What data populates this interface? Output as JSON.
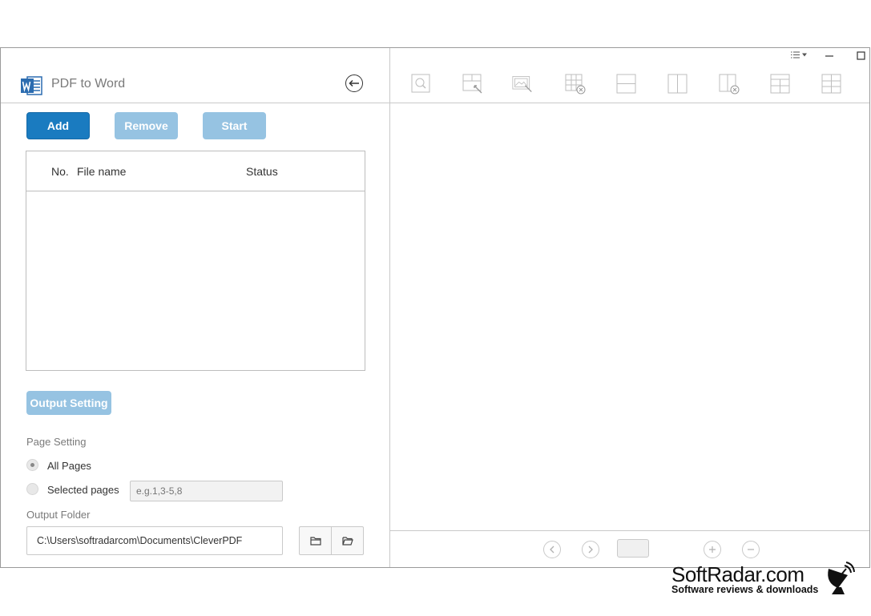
{
  "app": {
    "title": "PDF to Word"
  },
  "buttons": {
    "add": "Add",
    "remove": "Remove",
    "start": "Start",
    "output_setting": "Output Setting"
  },
  "file_table": {
    "columns": {
      "no": "No.",
      "file_name": "File name",
      "status": "Status"
    },
    "rows": []
  },
  "page_setting": {
    "label": "Page Setting",
    "all_pages": "All Pages",
    "selected_pages": "Selected pages",
    "selected_pages_placeholder": "e.g.1,3-5,8",
    "selected": "all_pages"
  },
  "output_folder": {
    "label": "Output Folder",
    "path": "C:\\Users\\softradarcom\\Documents\\CleverPDF"
  },
  "toolbar_icons": [
    "zoom-icon",
    "select-area-icon",
    "image-select-icon",
    "remove-table-icon",
    "horizontal-split-icon",
    "vertical-split-icon",
    "remove-column-icon",
    "insert-row-icon",
    "insert-column-icon"
  ],
  "watermark": {
    "name": "SoftRadar.com",
    "tagline": "Software reviews & downloads"
  },
  "colors": {
    "primary": "#1a7bc0",
    "primary_disabled": "#96c3e2",
    "border": "#c9c9c9",
    "muted_text": "#7a7a7a"
  }
}
